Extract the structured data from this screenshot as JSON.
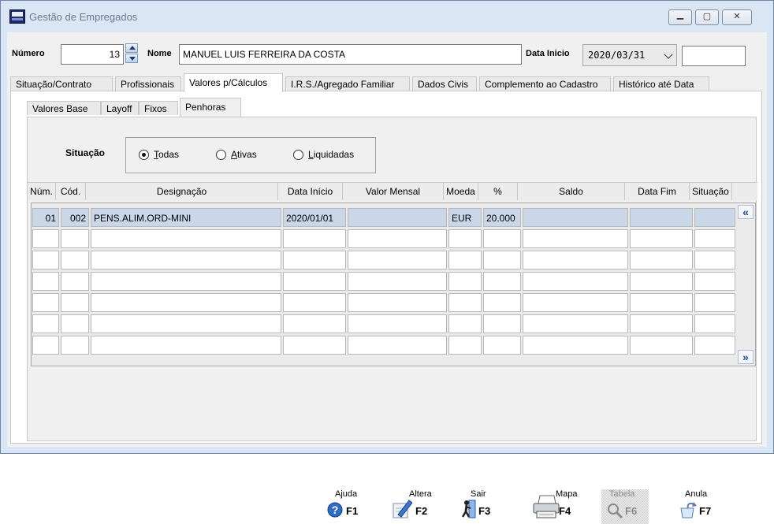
{
  "window": {
    "title": "Gestão de Empregados"
  },
  "header": {
    "numero_label": "Número",
    "numero_value": "13",
    "nome_label": "Nome",
    "nome_value": "MANUEL LUIS FERREIRA DA COSTA",
    "data_inicio_label": "Data Inicio",
    "data_inicio_value": "2020/03/31",
    "extra_value": ""
  },
  "tabs": [
    {
      "label": "Situação/Contrato",
      "active": false
    },
    {
      "label": "Profissionais",
      "active": false
    },
    {
      "label": "Valores p/Cálculos",
      "active": true
    },
    {
      "label": "I.R.S./Agregado Familiar",
      "active": false
    },
    {
      "label": "Dados Civis",
      "active": false
    },
    {
      "label": "Complemento ao Cadastro",
      "active": false
    },
    {
      "label": "Histórico até Data",
      "active": false
    }
  ],
  "subtabs": [
    {
      "label": "Valores Base",
      "active": false
    },
    {
      "label": "Layoff",
      "active": false
    },
    {
      "label": "Fixos",
      "active": false
    },
    {
      "label": "Penhoras",
      "active": true
    }
  ],
  "situacao": {
    "label": "Situação",
    "options": [
      {
        "label": "Todas",
        "accel": "T",
        "rest": "odas",
        "checked": true
      },
      {
        "label": "Ativas",
        "accel": "A",
        "rest": "tivas",
        "checked": false
      },
      {
        "label": "Liquidadas",
        "accel": "L",
        "rest": "iquidadas",
        "checked": false
      }
    ]
  },
  "grid": {
    "columns": [
      "Núm.",
      "Cód.",
      "Designação",
      "Data Início",
      "Valor Mensal",
      "Moeda",
      "%",
      "Saldo",
      "Data Fim",
      "Situação"
    ],
    "rows": [
      [
        "01",
        "002",
        "PENS.ALIM.ORD-MINI",
        "2020/01/01",
        "",
        "EUR",
        "20.000",
        "",
        "",
        ""
      ],
      [
        "",
        "",
        "",
        "",
        "",
        "",
        "",
        "",
        "",
        ""
      ],
      [
        "",
        "",
        "",
        "",
        "",
        "",
        "",
        "",
        "",
        ""
      ],
      [
        "",
        "",
        "",
        "",
        "",
        "",
        "",
        "",
        "",
        ""
      ],
      [
        "",
        "",
        "",
        "",
        "",
        "",
        "",
        "",
        "",
        ""
      ],
      [
        "",
        "",
        "",
        "",
        "",
        "",
        "",
        "",
        "",
        ""
      ],
      [
        "",
        "",
        "",
        "",
        "",
        "",
        "",
        "",
        "",
        ""
      ]
    ]
  },
  "toolbar": {
    "buttons": [
      {
        "name": "Ajuda",
        "key": "F1",
        "icon": "help-icon",
        "enabled": true
      },
      {
        "name": "Altera",
        "key": "F2",
        "icon": "edit-icon",
        "enabled": true
      },
      {
        "name": "Sair",
        "key": "F3",
        "icon": "exit-icon",
        "enabled": true
      },
      {
        "name": "Mapa",
        "key": "F4",
        "icon": "printer-icon",
        "enabled": true
      },
      {
        "name": "Tabela",
        "key": "F6",
        "icon": "search-icon",
        "enabled": false
      },
      {
        "name": "Anula",
        "key": "F7",
        "icon": "cancel-icon",
        "enabled": true
      }
    ]
  }
}
